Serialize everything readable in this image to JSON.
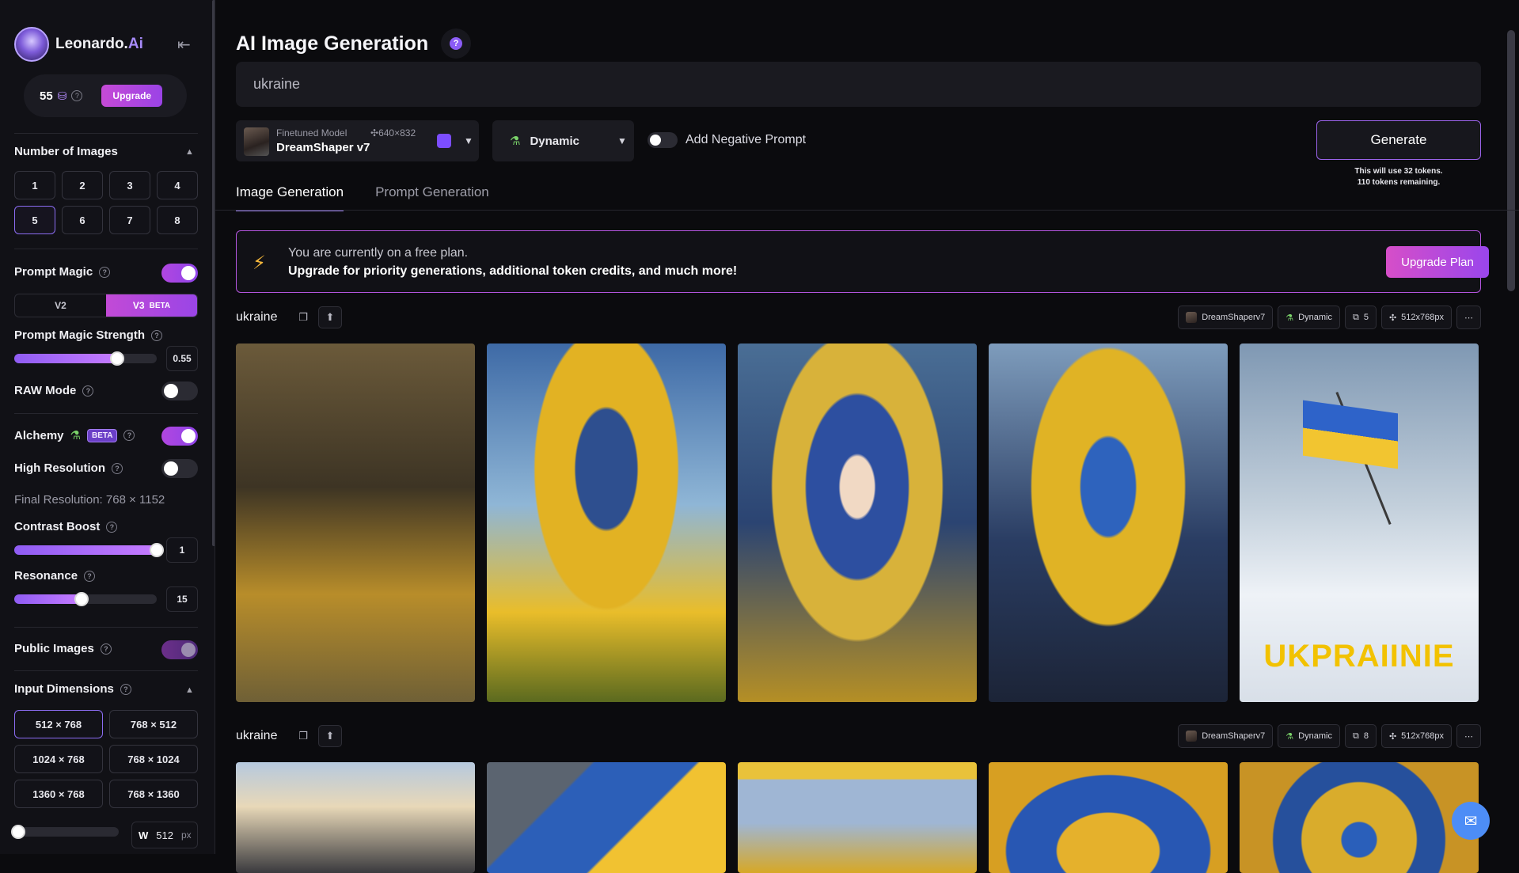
{
  "app": {
    "name": "Leonardo.",
    "name_suffix": "Ai"
  },
  "tokens": {
    "count": "55",
    "upgrade_label": "Upgrade"
  },
  "sidebar": {
    "number_of_images": {
      "title": "Number of Images",
      "options": [
        "1",
        "2",
        "3",
        "4",
        "5",
        "6",
        "7",
        "8"
      ],
      "selected": "5"
    },
    "prompt_magic": {
      "label": "Prompt Magic",
      "enabled": true,
      "versions": [
        "V2",
        "V3"
      ],
      "selected_version": "V3",
      "beta": "BETA"
    },
    "prompt_magic_strength": {
      "label": "Prompt Magic Strength",
      "value": "0.55",
      "fraction": 0.72
    },
    "raw_mode": {
      "label": "RAW Mode",
      "enabled": false
    },
    "alchemy": {
      "label": "Alchemy",
      "badge": "BETA",
      "enabled": true
    },
    "high_resolution": {
      "label": "High Resolution",
      "enabled": false
    },
    "final_resolution": "Final Resolution: 768 × 1152",
    "contrast_boost": {
      "label": "Contrast Boost",
      "value": "1",
      "fraction": 1.0
    },
    "resonance": {
      "label": "Resonance",
      "value": "15",
      "fraction": 0.47
    },
    "public_images": {
      "label": "Public Images",
      "enabled": true
    },
    "input_dimensions": {
      "title": "Input Dimensions",
      "options": [
        "512 × 768",
        "768 × 512",
        "1024 × 768",
        "768 × 1024",
        "1360 × 768",
        "768 × 1360"
      ],
      "selected": "512 × 768"
    },
    "width": {
      "label": "W",
      "value": "512",
      "unit": "px"
    }
  },
  "header": {
    "title": "AI Image Generation",
    "help": "?"
  },
  "prompt": {
    "value": "ukraine"
  },
  "model": {
    "label": "Finetuned Model",
    "dimensions": "640×832",
    "name": "DreamShaper v7"
  },
  "preset": {
    "name": "Dynamic"
  },
  "negative_prompt": {
    "label": "Add Negative Prompt",
    "enabled": false
  },
  "generate": {
    "label": "Generate",
    "note_line1": "This will use 32 tokens.",
    "note_line2": "110 tokens remaining."
  },
  "tabs": [
    "Image Generation",
    "Prompt Generation"
  ],
  "banner": {
    "line1": "You are currently on a free plan.",
    "line2": "Upgrade for priority generations, additional token credits, and much more!",
    "button": "Upgrade Plan"
  },
  "generations": [
    {
      "prompt": "ukraine",
      "model": "DreamShaperv7",
      "preset": "Dynamic",
      "count": "5",
      "size": "512x768px"
    },
    {
      "prompt": "ukraine",
      "model": "DreamShaperv7",
      "preset": "Dynamic",
      "count": "8",
      "size": "512x768px"
    }
  ],
  "image_overlay_text": "UKPRAIINIE",
  "colors": {
    "accent": "#a78bfa",
    "brand_gradient_start": "#c54ad6",
    "brand_gradient_end": "#9b43e6",
    "banner_border": "#b355dd"
  }
}
